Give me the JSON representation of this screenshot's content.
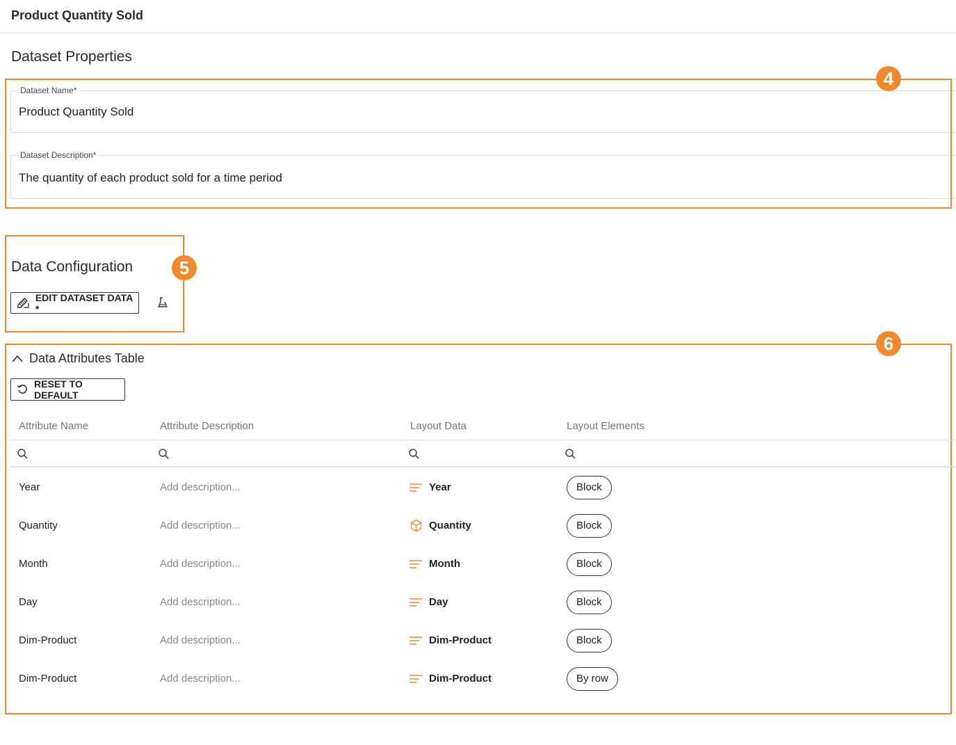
{
  "page_title": "Product Quantity Sold",
  "dataset_properties": {
    "title": "Dataset Properties",
    "name_label": "Dataset Name*",
    "name_value": "Product Quantity Sold",
    "description_label": "Dataset Description*",
    "description_value": "The quantity of each product sold for a time period"
  },
  "data_configuration": {
    "title": "Data Configuration",
    "edit_button": "EDIT DATASET DATA *"
  },
  "attributes_table": {
    "title": "Data Attributes Table",
    "reset_button": "RESET TO DEFAULT",
    "columns": [
      "Attribute Name",
      "Attribute Description",
      "Layout Data",
      "Layout Elements"
    ],
    "rows": [
      {
        "name": "Year",
        "description": "Add description...",
        "layout_icon": "lines-icon",
        "layout_data": "Year",
        "element": "Block"
      },
      {
        "name": "Quantity",
        "description": "Add description...",
        "layout_icon": "cube-icon",
        "layout_data": "Quantity",
        "element": "Block"
      },
      {
        "name": "Month",
        "description": "Add description...",
        "layout_icon": "lines-icon",
        "layout_data": "Month",
        "element": "Block"
      },
      {
        "name": "Day",
        "description": "Add description...",
        "layout_icon": "lines-icon",
        "layout_data": "Day",
        "element": "Block"
      },
      {
        "name": "Dim-Product",
        "description": "Add description...",
        "layout_icon": "lines-icon",
        "layout_data": "Dim-Product",
        "element": "Block"
      },
      {
        "name": "Dim-Product",
        "description": "Add description...",
        "layout_icon": "lines-icon",
        "layout_data": "Dim-Product",
        "element": "By row"
      }
    ]
  },
  "callouts": [
    "4",
    "5",
    "6"
  ],
  "colors": {
    "accent": "#f0892b",
    "border": "#333333",
    "muted": "#888888"
  }
}
